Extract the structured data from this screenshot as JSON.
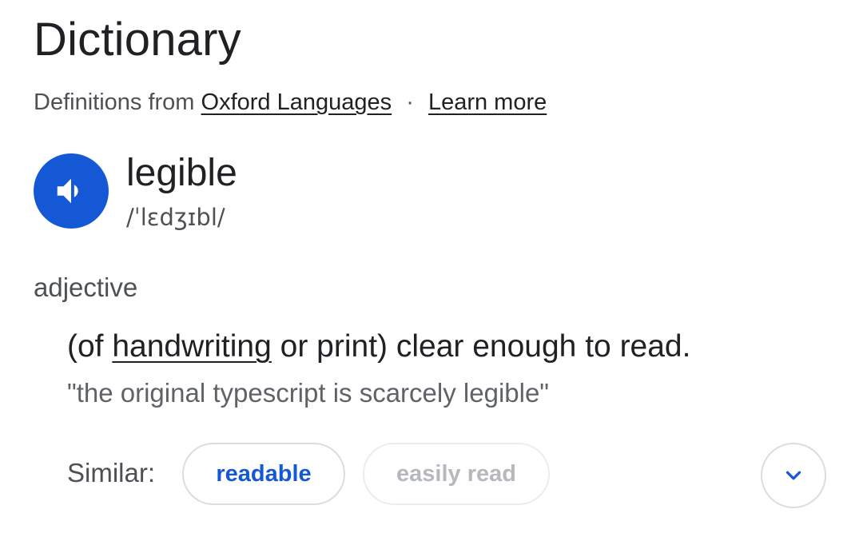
{
  "header": {
    "title": "Dictionary",
    "source_prefix": "Definitions from",
    "source_link": "Oxford Languages",
    "separator": "·",
    "learn_more": "Learn more"
  },
  "entry": {
    "word": "legible",
    "phonetic": "/ˈlɛdʒɪbl/",
    "speaker_icon": "speaker-icon",
    "part_of_speech": "adjective",
    "definition": {
      "prefix": "(of ",
      "link_word": "handwriting",
      "suffix": " or print) clear enough to read."
    },
    "example": "\"the original typescript is scarcely legible\""
  },
  "similar": {
    "label": "Similar:",
    "chips": [
      "readable",
      "easily read"
    ],
    "expand_icon": "chevron-down-icon"
  },
  "colors": {
    "accent": "#1558d6",
    "text_primary": "#202124",
    "text_secondary": "#4d5156",
    "chip_disabled": "#b5b8bc"
  }
}
